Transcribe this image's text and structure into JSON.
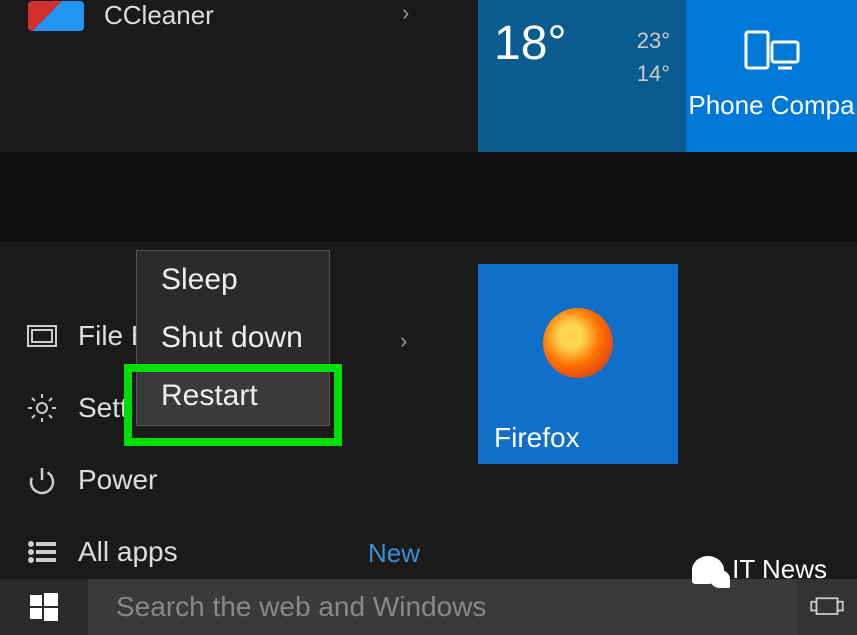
{
  "apps": {
    "ccleaner": "CCleaner"
  },
  "tiles": {
    "weather": {
      "main": "18°",
      "high": "23°",
      "low": "14°"
    },
    "phone": "Phone Compa",
    "firefox": "Firefox"
  },
  "menu": {
    "file_explorer": "File Ex",
    "settings": "Setti",
    "power": "Power",
    "all_apps": "All apps",
    "new_badge": "New"
  },
  "power_menu": {
    "sleep": "Sleep",
    "shutdown": "Shut down",
    "restart": "Restart"
  },
  "taskbar": {
    "search_placeholder": "Search the web and Windows"
  },
  "watermark": "IT News"
}
